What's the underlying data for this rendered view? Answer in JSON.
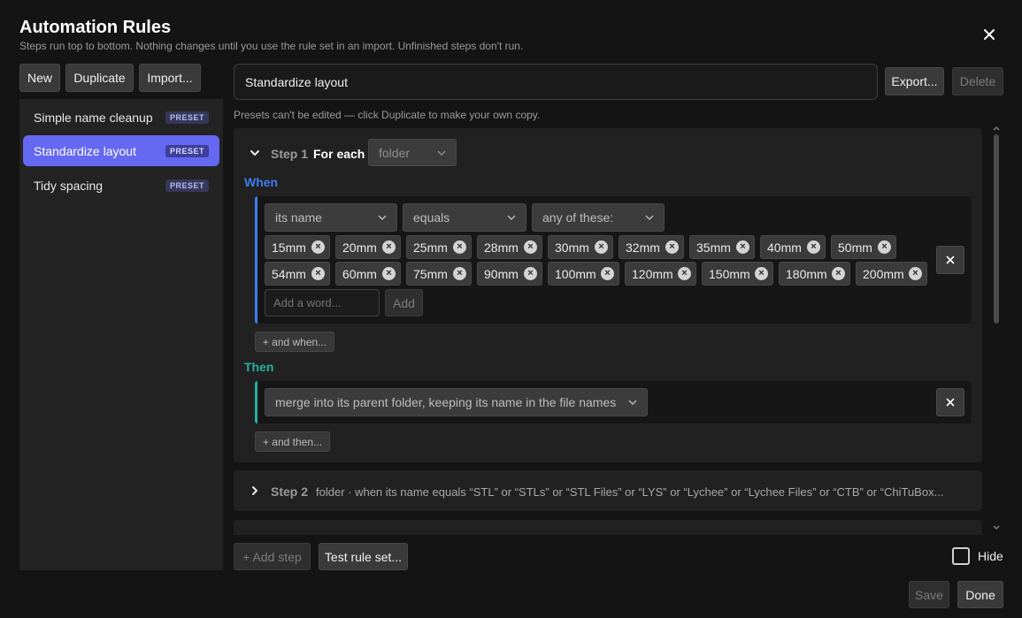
{
  "dialog": {
    "title": "Automation Rules",
    "subtitle": "Steps run top to bottom. Nothing changes until you use the rule set in an import. Unfinished steps don't run.",
    "close_icon": "close-icon"
  },
  "toolbar": {
    "new_label": "New",
    "duplicate_label": "Duplicate",
    "import_label": "Import...",
    "export_label": "Export...",
    "delete_label": "Delete"
  },
  "sidebar": {
    "items": [
      {
        "label": "Simple name cleanup",
        "badge": "PRESET",
        "selected": false
      },
      {
        "label": "Standardize layout",
        "badge": "PRESET",
        "selected": true
      },
      {
        "label": "Tidy spacing",
        "badge": "PRESET",
        "selected": false
      }
    ]
  },
  "rule": {
    "name_value": "Standardize layout",
    "hint": "Presets can't be edited — click Duplicate to make your own copy."
  },
  "step1": {
    "step_label": "Step 1",
    "for_each_label": "For each",
    "for_each_value": "folder",
    "when_label": "When",
    "then_label": "Then",
    "condition": {
      "field": "its name",
      "operator": "equals",
      "mode": "any of these:"
    },
    "chips": [
      "15mm",
      "20mm",
      "25mm",
      "28mm",
      "30mm",
      "32mm",
      "35mm",
      "40mm",
      "50mm",
      "54mm",
      "60mm",
      "75mm",
      "90mm",
      "100mm",
      "120mm",
      "150mm",
      "180mm",
      "200mm"
    ],
    "add_word_placeholder": "Add a word...",
    "add_label": "Add",
    "and_when_label": "+ and when...",
    "action_value": "merge into its parent folder, keeping its name in the file names",
    "and_then_label": "+ and then..."
  },
  "step2": {
    "step_label": "Step 2",
    "summary": "folder · when its name equals “STL” or “STLs” or “STL Files” or “LYS” or “Lychee” or “Lychee Files” or “CTB” or “ChiTuBox..."
  },
  "footer": {
    "add_step_label": "+ Add step",
    "test_label": "Test rule set...",
    "hide_label": "Hide",
    "save_label": "Save",
    "done_label": "Done"
  },
  "colors": {
    "accent": "#6568f0",
    "when": "#3f7df0",
    "then": "#27b0a0"
  }
}
